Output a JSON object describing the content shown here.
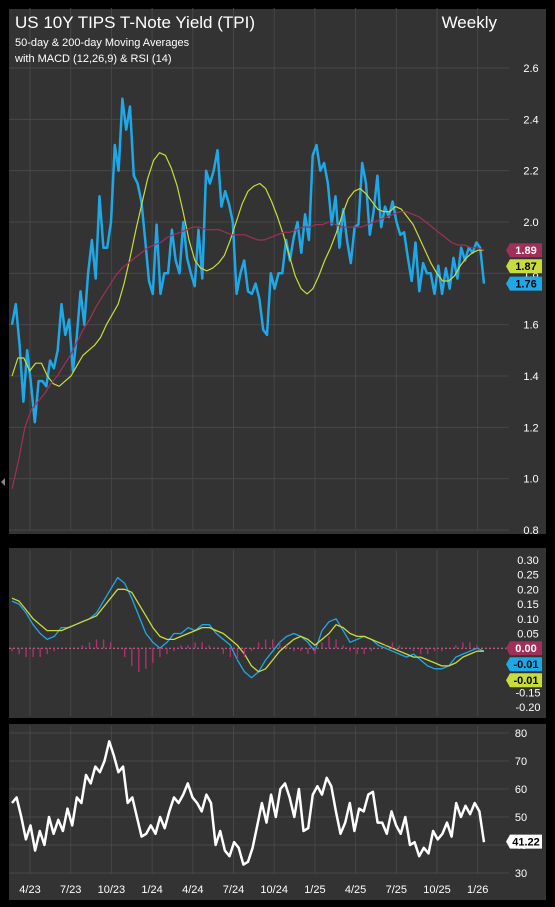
{
  "title": "US 10Y TIPS T-Note Yield (TPI)",
  "period": "Weekly",
  "subtitle1": "50-day & 200-day Moving Averages",
  "subtitle2": "with MACD (12,26,9) & RSI (14)",
  "colors": {
    "background": "#333333",
    "frame": "#000000",
    "grid": "#474747",
    "price": "#1ea8e8",
    "ma50": "#c8dc3c",
    "ma200": "#a0305a",
    "macd": "#1ea8e8",
    "signal": "#c8dc3c",
    "histogram": "#b0306e",
    "rsi": "#ffffff",
    "text": "#ffffff"
  },
  "chart_data": [
    {
      "type": "line",
      "panel": "price",
      "ylim": [
        0.8,
        2.6
      ],
      "yticks": [
        "0.8",
        "1.0",
        "1.2",
        "1.4",
        "1.6",
        "1.8",
        "2.0",
        "2.2",
        "2.4",
        "2.6"
      ],
      "grid": true,
      "x": [
        "4/23",
        "7/23",
        "10/23",
        "1/24",
        "4/24",
        "7/24",
        "10/24",
        "1/25",
        "4/25",
        "7/25",
        "10/25",
        "1/26"
      ],
      "series": [
        {
          "name": "price",
          "values": [
            1.6,
            1.68,
            1.52,
            1.3,
            1.5,
            1.37,
            1.22,
            1.38,
            1.38,
            1.36,
            1.46,
            1.43,
            1.5,
            1.68,
            1.56,
            1.62,
            1.42,
            1.55,
            1.73,
            1.6,
            1.8,
            1.93,
            1.78,
            2.1,
            1.9,
            1.9,
            2.0,
            2.3,
            2.2,
            2.48,
            2.36,
            2.45,
            2.18,
            2.15,
            2.08,
            1.93,
            1.77,
            1.72,
            1.99,
            1.72,
            1.8,
            1.8,
            1.97,
            1.85,
            1.8,
            2.0,
            1.86,
            1.8,
            1.75,
            1.97,
            1.78,
            2.2,
            2.15,
            2.2,
            2.28,
            2.06,
            2.12,
            2.07,
            2.0,
            1.72,
            1.8,
            1.85,
            1.73,
            1.72,
            1.76,
            1.7,
            1.58,
            1.56,
            1.8,
            1.74,
            1.8,
            1.8,
            1.93,
            1.85,
            1.94,
            2.0,
            1.88,
            2.03,
            1.93,
            2.26,
            2.3,
            2.2,
            2.23,
            2.15,
            1.99,
            2.1,
            1.9,
            2.05,
            1.93,
            1.84,
            1.98,
            1.99,
            2.23,
            2.15,
            1.95,
            2.04,
            2.18,
            1.98,
            2.06,
            2.02,
            2.08,
            2.0,
            1.95,
            1.96,
            1.86,
            1.77,
            1.92,
            1.73,
            1.84,
            1.8,
            1.8,
            1.72,
            1.83,
            1.72,
            1.82,
            1.74,
            1.86,
            1.78,
            1.9,
            1.85,
            1.9,
            1.88,
            1.92,
            1.9,
            1.76
          ]
        },
        {
          "name": "50-day MA",
          "values": [
            1.4,
            1.47,
            1.47,
            1.42,
            1.45,
            1.45,
            1.4,
            1.37,
            1.36,
            1.38,
            1.4,
            1.44,
            1.48,
            1.5,
            1.52,
            1.55,
            1.6,
            1.64,
            1.68,
            1.76,
            1.86,
            1.97,
            2.07,
            2.17,
            2.24,
            2.27,
            2.26,
            2.21,
            2.14,
            2.04,
            1.93,
            1.85,
            1.82,
            1.81,
            1.82,
            1.84,
            1.87,
            1.93,
            2.0,
            2.07,
            2.12,
            2.14,
            2.15,
            2.13,
            2.08,
            2.02,
            1.95,
            1.87,
            1.79,
            1.74,
            1.72,
            1.74,
            1.79,
            1.85,
            1.9,
            1.96,
            2.03,
            2.09,
            2.12,
            2.13,
            2.11,
            2.08,
            2.05,
            2.04,
            2.04,
            2.06,
            2.05,
            2.02,
            1.99,
            1.94,
            1.89,
            1.84,
            1.8,
            1.77,
            1.77,
            1.79,
            1.83,
            1.86,
            1.88,
            1.89,
            1.89
          ]
        },
        {
          "name": "200-day MA",
          "values": [
            0.96,
            1.07,
            1.2,
            1.27,
            1.3,
            1.33,
            1.37,
            1.4,
            1.44,
            1.48,
            1.53,
            1.58,
            1.62,
            1.67,
            1.71,
            1.75,
            1.79,
            1.82,
            1.84,
            1.86,
            1.88,
            1.9,
            1.91,
            1.92,
            1.94,
            1.95,
            1.96,
            1.97,
            1.98,
            1.98,
            1.97,
            1.97,
            1.97,
            1.96,
            1.95,
            1.95,
            1.95,
            1.94,
            1.93,
            1.93,
            1.94,
            1.95,
            1.96,
            1.96,
            1.97,
            1.98,
            1.98,
            1.99,
            1.99,
            2.0,
            1.99,
            1.98,
            1.98,
            1.98,
            1.98,
            1.99,
            2.0,
            2.01,
            2.02,
            2.03,
            2.04,
            2.04,
            2.03,
            2.02,
            2.0,
            1.98,
            1.96,
            1.94,
            1.92,
            1.91,
            1.91,
            1.9,
            1.9,
            1.89
          ]
        }
      ],
      "last_labels": [
        {
          "text": "1.89",
          "value": 1.89,
          "color": "#a0305a"
        },
        {
          "text": "1.87",
          "value": 1.87,
          "color": "#c8dc3c"
        },
        {
          "text": "1.76",
          "value": 1.76,
          "color": "#1ea8e8"
        }
      ]
    },
    {
      "type": "line",
      "panel": "macd",
      "ylim": [
        -0.22,
        0.32
      ],
      "yticks": [
        "0.30",
        "0.25",
        "0.20",
        "0.15",
        "0.10",
        "0.05",
        "0.00",
        "-0.05",
        "-0.10",
        "-0.15",
        "-0.20"
      ],
      "series": [
        {
          "name": "MACD",
          "values": [
            0.16,
            0.15,
            0.12,
            0.08,
            0.05,
            0.03,
            0.04,
            0.07,
            0.07,
            0.08,
            0.09,
            0.1,
            0.12,
            0.16,
            0.2,
            0.24,
            0.22,
            0.17,
            0.11,
            0.05,
            0.02,
            0.0,
            0.02,
            0.05,
            0.05,
            0.07,
            0.06,
            0.08,
            0.08,
            0.05,
            0.03,
            0.01,
            -0.04,
            -0.08,
            -0.1,
            -0.08,
            -0.04,
            -0.01,
            0.02,
            0.04,
            0.05,
            0.04,
            0.02,
            -0.01,
            0.06,
            0.09,
            0.1,
            0.06,
            0.02,
            0.03,
            0.04,
            0.03,
            0.01,
            0.0,
            -0.01,
            -0.02,
            -0.03,
            -0.02,
            -0.04,
            -0.06,
            -0.07,
            -0.07,
            -0.06,
            -0.03,
            -0.02,
            -0.01,
            0.0,
            -0.01
          ]
        },
        {
          "name": "Signal",
          "values": [
            0.17,
            0.16,
            0.13,
            0.1,
            0.08,
            0.06,
            0.06,
            0.06,
            0.07,
            0.08,
            0.09,
            0.1,
            0.11,
            0.14,
            0.17,
            0.2,
            0.2,
            0.19,
            0.15,
            0.11,
            0.07,
            0.04,
            0.03,
            0.03,
            0.04,
            0.05,
            0.06,
            0.07,
            0.07,
            0.06,
            0.05,
            0.03,
            0.01,
            -0.02,
            -0.06,
            -0.08,
            -0.07,
            -0.04,
            -0.01,
            0.01,
            0.03,
            0.04,
            0.03,
            0.01,
            0.03,
            0.05,
            0.08,
            0.07,
            0.05,
            0.04,
            0.04,
            0.03,
            0.02,
            0.01,
            0.0,
            -0.01,
            -0.02,
            -0.03,
            -0.03,
            -0.04,
            -0.05,
            -0.06,
            -0.06,
            -0.05,
            -0.03,
            -0.02,
            -0.01,
            -0.01
          ]
        },
        {
          "name": "Histogram",
          "values": [
            -0.01,
            -0.02,
            -0.03,
            -0.03,
            -0.03,
            -0.02,
            -0.01,
            0.0,
            0.0,
            0.0,
            0.01,
            0.02,
            0.03,
            0.03,
            0.02,
            0.0,
            -0.03,
            -0.06,
            -0.08,
            -0.07,
            -0.05,
            -0.03,
            -0.02,
            -0.01,
            0.01,
            0.01,
            0.02,
            0.02,
            0.01,
            0.0,
            -0.02,
            -0.03,
            -0.04,
            -0.03,
            -0.01,
            0.02,
            0.03,
            0.03,
            0.02,
            0.01,
            -0.01,
            -0.01,
            -0.02,
            -0.02,
            0.02,
            0.04,
            0.03,
            0.01,
            -0.01,
            -0.02,
            -0.02,
            -0.01,
            0.0,
            0.01,
            0.02,
            0.01,
            0.0,
            -0.01,
            -0.02,
            -0.02,
            -0.01,
            -0.01,
            0.0,
            0.01,
            0.02,
            0.02,
            0.01,
            0.0
          ]
        }
      ],
      "last_labels": [
        {
          "text": "0.00",
          "value": 0.0,
          "color": "#a0305a"
        },
        {
          "text": "-0.01",
          "value": -0.01,
          "color": "#1ea8e8"
        },
        {
          "text": "-0.01",
          "value": -0.01,
          "color": "#c8dc3c"
        }
      ]
    },
    {
      "type": "line",
      "panel": "rsi",
      "ylim": [
        30,
        80
      ],
      "yticks": [
        "80",
        "70",
        "60",
        "50",
        "40",
        "30"
      ],
      "series": [
        {
          "name": "RSI",
          "values": [
            55,
            57,
            50,
            42,
            47,
            38,
            45,
            40,
            50,
            44,
            49,
            45,
            53,
            47,
            57,
            55,
            65,
            62,
            68,
            66,
            70,
            77,
            72,
            66,
            68,
            55,
            57,
            50,
            43,
            44,
            47,
            44,
            50,
            46,
            52,
            57,
            55,
            58,
            62,
            57,
            55,
            52,
            58,
            55,
            40,
            45,
            38,
            36,
            41,
            39,
            33,
            34,
            39,
            47,
            55,
            48,
            58,
            50,
            60,
            62,
            57,
            50,
            60,
            45,
            46,
            58,
            61,
            58,
            64,
            61,
            52,
            44,
            48,
            55,
            45,
            53,
            52,
            58,
            59,
            48,
            48,
            44,
            52,
            47,
            44,
            50,
            40,
            41,
            36,
            39,
            37,
            45,
            42,
            44,
            48,
            43,
            55,
            50,
            54,
            51,
            55,
            52,
            41
          ]
        }
      ],
      "last_labels": [
        {
          "text": "41.22",
          "value": 41.22,
          "color": "#ffffff"
        }
      ]
    }
  ]
}
